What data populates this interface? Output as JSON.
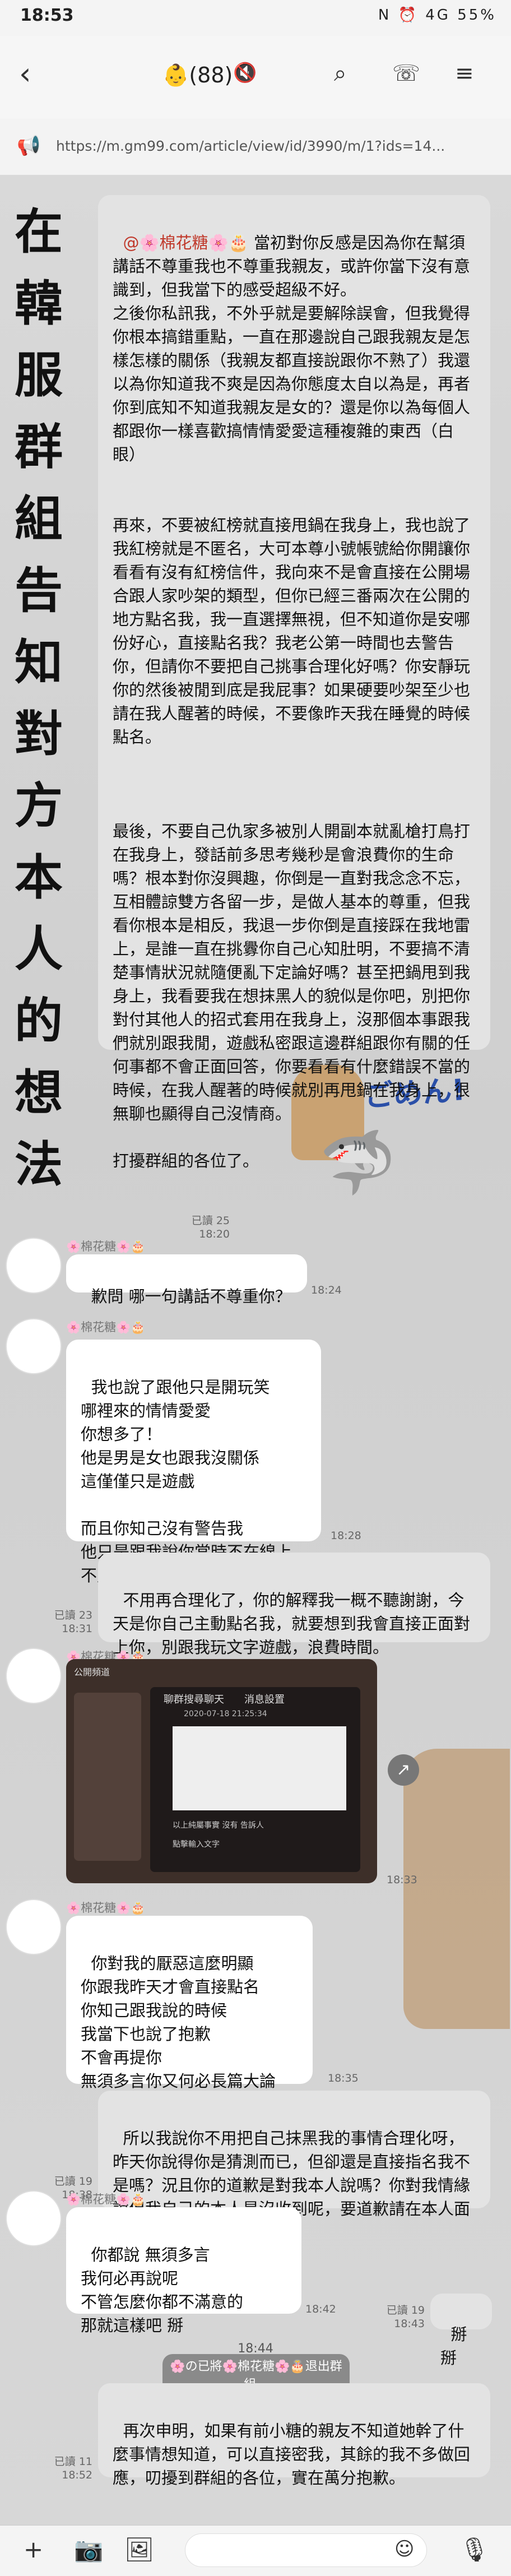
{
  "status": {
    "time": "18:53",
    "indicators": "N ⏰ 4G 55%"
  },
  "header": {
    "title": "(88)",
    "icons": [
      "back-icon",
      "avatar-emoji",
      "mute-icon",
      "search-icon",
      "call-icon",
      "menu-icon"
    ]
  },
  "url": "https://m.gm99.com/article/view/id/3990/m/1?ids=14...",
  "side_text": [
    "在",
    "韓",
    "服",
    "群",
    "組",
    "告",
    "知",
    "對",
    "方",
    "本",
    "人",
    "的",
    "想",
    "法"
  ],
  "messages": [
    {
      "id": "m1",
      "dir": "out",
      "mention": "@🌸棉花糖🌸🎂",
      "text": " 當初對你反感是因為你在幫須講話不尊重我也不尊重我親友，或許你當下沒有意識到，但我當下的感受超級不好。\n之後你私訊我，不外乎就是要解除誤會，但我覺得你根本搞錯重點，一直在那邊說自己跟我親友是怎樣怎樣的關係（我親友都直接說跟你不熟了）我還以為你知道我不爽是因為你態度太自以為是，再者你到底知不知道我親友是女的？還是你以為每個人都跟你一樣喜歡搞情情愛愛這種複雜的東西（白眼）\n\n\n再來，不要被紅榜就直接甩鍋在我身上，我也說了我紅榜就是不匿名，大可本尊小號帳號給你開讓你看看有沒有紅榜信件，我向來不是會直接在公開場合跟人家吵架的類型，但你已經三番兩次在公開的地方點名我，我一直選擇無視，但不知道你是安哪份好心，直接點名我？我老公第一時間也去警告你，但請你不要把自己挑事合理化好嗎？你安靜玩你的然後被閒到底是我屁事？如果硬要吵架至少也請在我人醒著的時候，不要像昨天我在睡覺的時候點名。\n\n\n\n最後，不要自己仇家多被別人開副本就亂槍打鳥打在我身上，發話前多思考幾秒是會浪費你的生命嗎？根本對你沒興趣，你倒是一直對我念念不忘，互相體諒雙方各留一步，是做人基本的尊重，但我看你根本是相反，我退一步你倒是直接踩在我地雷上，是誰一直在挑釁你自己心知肚明，不要搞不清楚事情狀況就隨便亂下定論好嗎？甚至把鍋甩到我身上，我看要我在想抹黑人的貌似是你吧，別把你對付其他人的招式套用在我身上，沒那個本事跟我們就別跟我閒，遊戲私密跟這邊群組跟你有關的任何事都不會正面回答，你要看看有什麼錯誤不當的時候，在我人醒著的時候就別再甩鍋在我身上，很無聊也顯得自己沒情商。\n\n打擾群組的各位了。",
      "meta": "已讀 25\n18:20"
    },
    {
      "id": "m2",
      "dir": "in",
      "sender": "🌸棉花糖🌸🎂",
      "text": "歉問 哪一句講話不尊重你？",
      "meta": "18:24"
    },
    {
      "id": "m3",
      "dir": "in",
      "sender": "🌸棉花糖🌸🎂",
      "text": "我也說了跟他只是開玩笑\n哪裡來的情情愛愛\n你想多了！\n他是男是女也跟我沒關係\n這僅僅只是遊戲\n\n而且你知己沒有警告我\n他只是跟我說你當時不在線上\n不用過分誇大",
      "meta": "18:28"
    },
    {
      "id": "m4",
      "dir": "out",
      "text": "不用再合理化了，你的解釋我一概不聽謝謝，今天是你自己主動點名我，就要想到我會直接正面對上你，別跟我玩文字遊戲，浪費時間。",
      "meta": "已讀 23\n18:31"
    },
    {
      "id": "m5",
      "dir": "in",
      "sender": "🌸棉花糖🌸🎂",
      "image": true,
      "meta": "18:33",
      "image_texts": {
        "tab": "聊群搜尋聊天",
        "head": "消息設置",
        "time": "2020-07-18 21:25:34",
        "caption": "以上純屬事實 沒有 告訴人",
        "input": "點擊輸入文字",
        "left": "公開頻道"
      }
    },
    {
      "id": "m6",
      "dir": "in",
      "sender": "🌸棉花糖🌸🎂",
      "text": "你對我的厭惡這麼明顯\n你跟我昨天才會直接點名\n你知己跟我說的時候\n我當下也說了抱歉\n不會再提你\n無須多言你又何必長篇大論",
      "meta": "18:35"
    },
    {
      "id": "m7",
      "dir": "out",
      "text": "所以我說你不用把自己抹黑我的事情合理化呀，昨天你說得你是猜測而已，但卻還是直接指名我不是嗎？況且你的道歉是對我本人說嗎？你對我情緣說但我自己的本人是沒收到呢，要道歉請在本人面前道歉謝謝。",
      "meta": "已讀 19\n18:38"
    },
    {
      "id": "m8",
      "dir": "in",
      "sender": "🌸棉花糖🌸🎂",
      "text": "你都說 無須多言\n我何必再說呢\n不管怎麼你都不滿意的\n那就這樣吧 掰",
      "meta": "18:42"
    },
    {
      "id": "m9",
      "dir": "out",
      "text": "掰掰",
      "meta": "已讀 19\n18:43"
    },
    {
      "id": "m10",
      "dir": "out",
      "text": "再次申明，如果有前小糖的親友不知道她幹了什麼事情想知道，可以直接密我，其餘的我不多做回應，叨擾到群組的各位，實在萬分抱歉。",
      "meta": "已讀 11\n18:52"
    }
  ],
  "system": {
    "time": "18:44",
    "text": "🌸の已將🌸棉花糖🌸🎂退出群組。"
  },
  "stickers": {
    "gomen": "ごめん!"
  },
  "bottom": {
    "placeholder": ""
  }
}
